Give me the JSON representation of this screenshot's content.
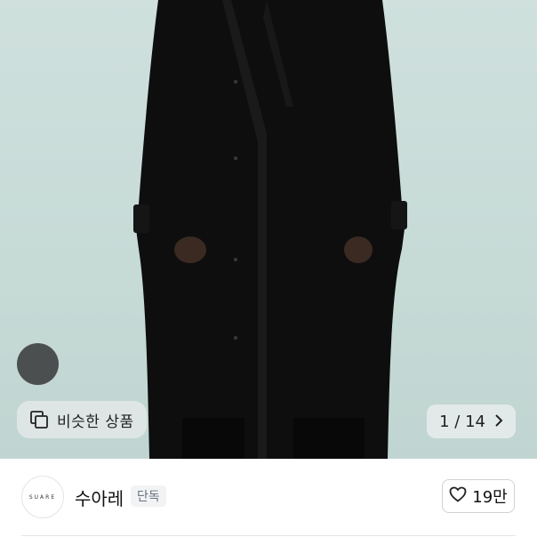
{
  "product_image": {
    "alt": "black long coat",
    "similar_products_label": "비슷한 상품",
    "pager_text": "1 / 14",
    "current_index": 1,
    "total": 14
  },
  "seller": {
    "logo_text": "SUARE",
    "name": "수아레",
    "badge": "단독",
    "likes": "19만"
  },
  "colors": {
    "background": "#c6dad6",
    "coat": "#0e0e0e"
  },
  "icons": {
    "similar": "copy-squares-icon",
    "next": "chevron-right-icon",
    "heart": "heart-outline-icon"
  }
}
